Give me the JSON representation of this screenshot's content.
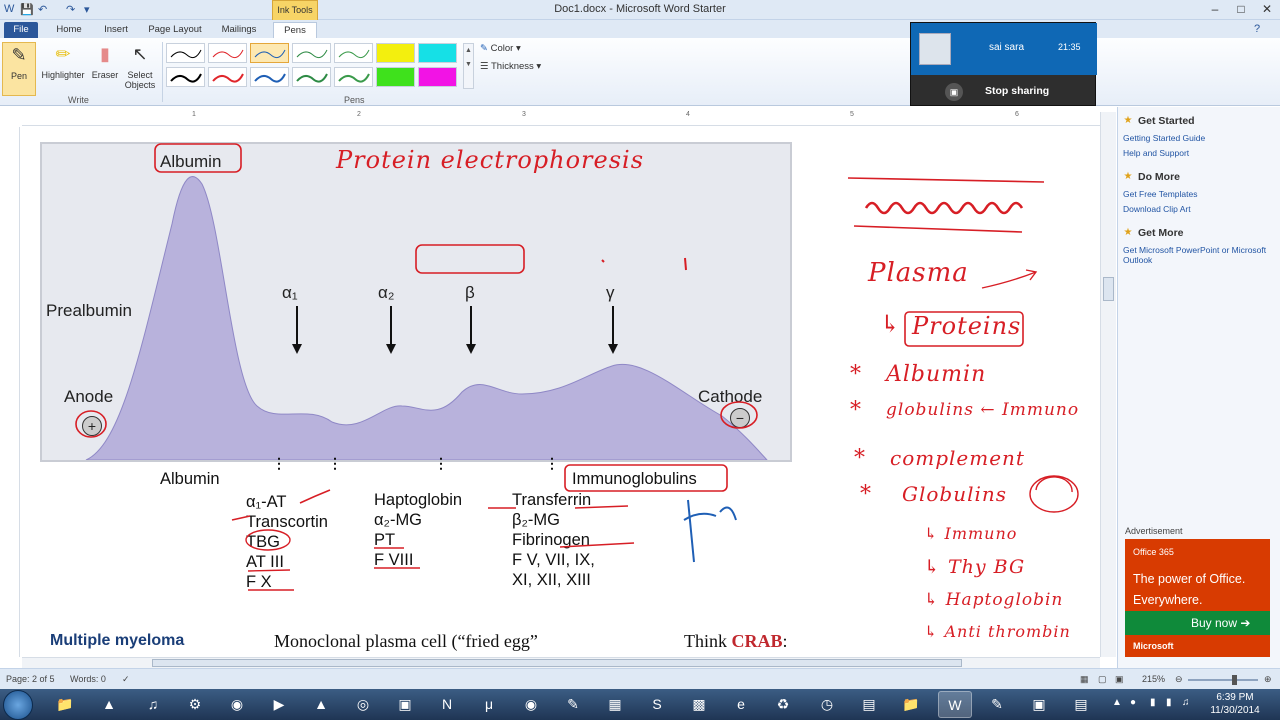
{
  "window": {
    "title": "Doc1.docx - Microsoft Word Starter",
    "contextual_tab_group": "Ink Tools"
  },
  "tabs": [
    "File",
    "Home",
    "Insert",
    "Page Layout",
    "Mailings",
    "Pens"
  ],
  "ribbon": {
    "write_tools": [
      "Pen",
      "Highlighter",
      "Eraser",
      "Select Objects"
    ],
    "write_group_label": "Write",
    "pens_group_label": "Pens",
    "color_label": "Color",
    "thickness_label": "Thickness",
    "pen_colors": [
      "#000000",
      "#e0262b",
      "#1f5fb5",
      "#2e8b45",
      "#3a9a4a",
      "#f3ef0e",
      "#16e0e6",
      "#000000",
      "#e0262b",
      "#1f5fb5",
      "#2e8b45",
      "#3a9a4a",
      "#3fe11c",
      "#f213e5"
    ]
  },
  "sharing": {
    "name": "sai sara",
    "time": "21:35",
    "stop_label": "Stop sharing"
  },
  "figure": {
    "peak_label": "Albumin",
    "left_label": "Prealbumin",
    "anode": "Anode",
    "cathode": "Cathode",
    "anode_sign": "+",
    "cathode_sign": "−",
    "zones": [
      "α₁",
      "α₂",
      "β",
      "γ"
    ]
  },
  "doc": {
    "col1_title": "Albumin",
    "col2_lines": [
      "α₁-AT",
      "Transcortin",
      "TBG",
      "AT III",
      "F X"
    ],
    "col3_lines": [
      "Haptoglobin",
      "α₂-MG",
      "PT",
      "F VIII"
    ],
    "col4_lines": [
      "Transferrin",
      "β₂-MG",
      "Fibrinogen",
      "F V, VII, IX,",
      "XI, XII, XIII"
    ],
    "col4_title": "Immunoglobulins",
    "bottom_left": "Multiple myeloma",
    "bottom_mid": "Monoclonal plasma cell (“fried egg”",
    "bottom_right_prefix": "Think ",
    "bottom_right_accent": "CRAB",
    "bottom_right_suffix": ":"
  },
  "ink_notes": {
    "title": "Protein electrophoresis",
    "globulins_box": "Globulins",
    "plasma": "Plasma",
    "proteins": "Proteins",
    "list": [
      "Albumin",
      "globulins ← Immuno",
      "complement",
      "Globulins"
    ],
    "sub_list": [
      "↳ Immuno",
      "↳ Thy BG",
      "↳ Haptoglobin",
      "↳ Anti thrombin"
    ]
  },
  "task_pane": {
    "sections": [
      {
        "heading": "Get Started",
        "links": [
          "Getting Started Guide",
          "Help and Support"
        ]
      },
      {
        "heading": "Do More",
        "links": [
          "Get Free Templates",
          "Download Clip Art"
        ]
      },
      {
        "heading": "Get More",
        "links": [
          "Get Microsoft PowerPoint or Microsoft Outlook"
        ]
      }
    ],
    "ad_label": "Advertisement",
    "ad_brand": "Office 365",
    "ad_headline": "The power of Office. Everywhere.",
    "ad_button": "Buy now",
    "ad_footer": "Microsoft"
  },
  "status": {
    "page": "Page: 2 of 5",
    "words": "Words: 0",
    "zoom": "215%"
  },
  "taskbar": {
    "time": "6:39 PM",
    "date": "11/30/2014"
  },
  "colors": {
    "ink_red": "#d71e25",
    "ink_blue": "#1f5fb5",
    "word_blue": "#2b579a",
    "curve_fill": "#b8b2dc"
  }
}
